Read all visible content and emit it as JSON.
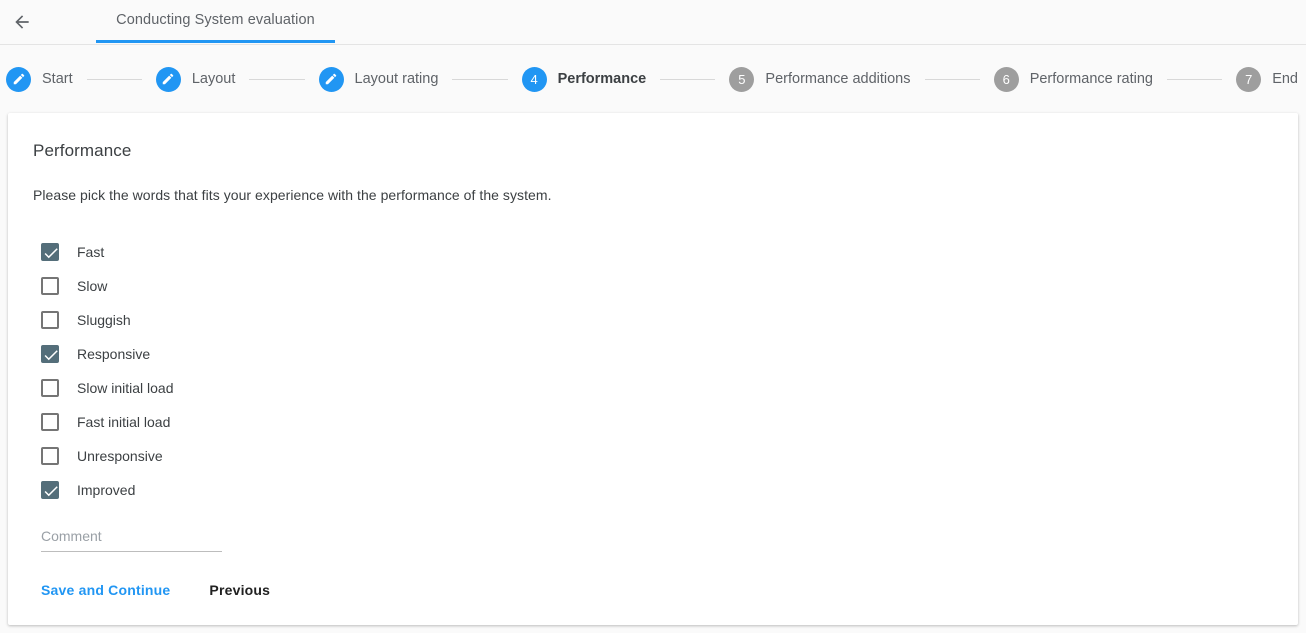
{
  "topbar": {
    "back_icon": "arrow-left-icon",
    "tab_label": "Conducting System evaluation",
    "accent_color": "#2196f3"
  },
  "stepper": {
    "steps": [
      {
        "label": "Start",
        "marker": "pencil-icon",
        "state": "done"
      },
      {
        "label": "Layout",
        "marker": "pencil-icon",
        "state": "done"
      },
      {
        "label": "Layout rating",
        "marker": "pencil-icon",
        "state": "done"
      },
      {
        "label": "Performance",
        "marker": "4",
        "state": "active"
      },
      {
        "label": "Performance additions",
        "marker": "5",
        "state": "todo"
      },
      {
        "label": "Performance rating",
        "marker": "6",
        "state": "todo"
      },
      {
        "label": "End",
        "marker": "7",
        "state": "todo"
      }
    ],
    "done_color": "#2196f3",
    "active_color": "#2196f3",
    "todo_color": "#9e9e9e"
  },
  "main": {
    "title": "Performance",
    "description": "Please pick the words that fits your experience with the performance of the system.",
    "checkbox_checked_color": "#546e7a",
    "options": [
      {
        "label": "Fast",
        "checked": true
      },
      {
        "label": "Slow",
        "checked": false
      },
      {
        "label": "Sluggish",
        "checked": false
      },
      {
        "label": "Responsive",
        "checked": true
      },
      {
        "label": "Slow initial load",
        "checked": false
      },
      {
        "label": "Fast initial load",
        "checked": false
      },
      {
        "label": "Unresponsive",
        "checked": false
      },
      {
        "label": "Improved",
        "checked": true
      }
    ],
    "comment": {
      "value": "",
      "placeholder": "Comment"
    },
    "buttons": {
      "save": "Save and Continue",
      "previous": "Previous"
    }
  }
}
